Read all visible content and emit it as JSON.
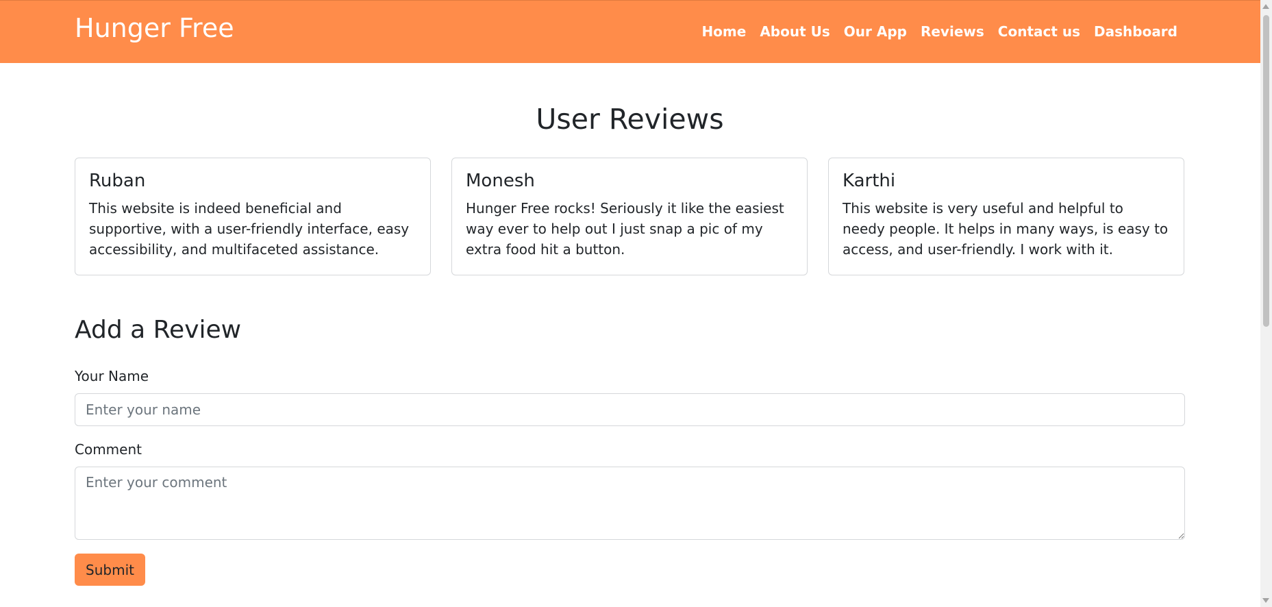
{
  "navbar": {
    "brand": "Hunger Free",
    "links": [
      "Home",
      "About Us",
      "Our App",
      "Reviews",
      "Contact us",
      "Dashboard"
    ]
  },
  "reviews_section": {
    "title": "User Reviews",
    "reviews": [
      {
        "name": "Ruban",
        "text": "This website is indeed beneficial and supportive, with a user-friendly interface, easy accessibility, and multifaceted assistance."
      },
      {
        "name": "Monesh",
        "text": "Hunger Free rocks! Seriously it like the easiest way ever to help out I just snap a pic of my extra food hit a button."
      },
      {
        "name": "Karthi",
        "text": "This website is very useful and helpful to needy people. It helps in many ways, is easy to access, and user-friendly. I work with it."
      }
    ]
  },
  "form": {
    "title": "Add a Review",
    "name_label": "Your Name",
    "name_placeholder": "Enter your name",
    "name_value": "",
    "comment_label": "Comment",
    "comment_placeholder": "Enter your comment",
    "comment_value": "",
    "submit_label": "Submit"
  },
  "colors": {
    "accent": "#ff8c4a",
    "text": "#212529",
    "border": "#d5d7da"
  }
}
